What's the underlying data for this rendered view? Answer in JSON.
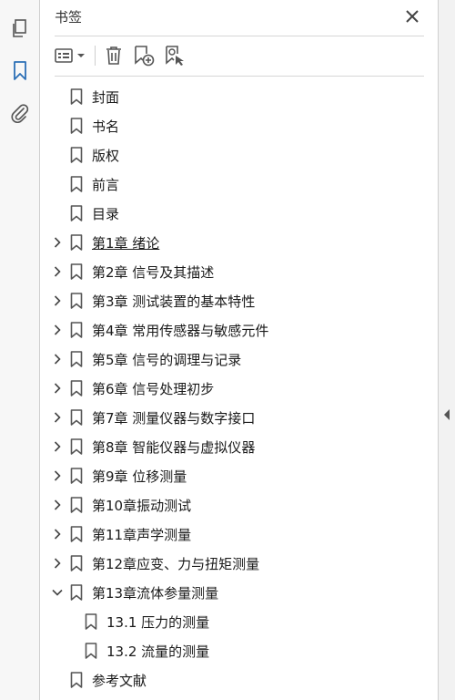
{
  "panel": {
    "title": "书签"
  },
  "left_rail": {
    "items": [
      {
        "name": "pages-icon",
        "active": false
      },
      {
        "name": "bookmark-icon",
        "active": true
      },
      {
        "name": "attachment-icon",
        "active": false
      }
    ]
  },
  "toolbar": {
    "options_icon": "list-options-icon",
    "delete_icon": "trash-icon",
    "new_bookmark_icon": "new-bookmark-icon",
    "bookmark_from_selection_icon": "bookmark-find-icon"
  },
  "bookmarks": [
    {
      "label": "封面",
      "level": 1,
      "expandable": false
    },
    {
      "label": "书名",
      "level": 1,
      "expandable": false
    },
    {
      "label": "版权",
      "level": 1,
      "expandable": false
    },
    {
      "label": "前言",
      "level": 1,
      "expandable": false
    },
    {
      "label": "目录",
      "level": 1,
      "expandable": false
    },
    {
      "label": "第1章 绪论",
      "level": 1,
      "expandable": true,
      "expanded": false,
      "hovered": true
    },
    {
      "label": "第2章 信号及其描述",
      "level": 1,
      "expandable": true,
      "expanded": false
    },
    {
      "label": "第3章 测试装置的基本特性",
      "level": 1,
      "expandable": true,
      "expanded": false
    },
    {
      "label": "第4章 常用传感器与敏感元件",
      "level": 1,
      "expandable": true,
      "expanded": false
    },
    {
      "label": "第5章 信号的调理与记录",
      "level": 1,
      "expandable": true,
      "expanded": false
    },
    {
      "label": "第6章 信号处理初步",
      "level": 1,
      "expandable": true,
      "expanded": false
    },
    {
      "label": "第7章 测量仪器与数字接口",
      "level": 1,
      "expandable": true,
      "expanded": false
    },
    {
      "label": "第8章 智能仪器与虚拟仪器",
      "level": 1,
      "expandable": true,
      "expanded": false
    },
    {
      "label": "第9章 位移测量",
      "level": 1,
      "expandable": true,
      "expanded": false
    },
    {
      "label": "第10章振动测试",
      "level": 1,
      "expandable": true,
      "expanded": false
    },
    {
      "label": "第11章声学测量",
      "level": 1,
      "expandable": true,
      "expanded": false
    },
    {
      "label": "第12章应变、力与扭矩测量",
      "level": 1,
      "expandable": true,
      "expanded": false
    },
    {
      "label": "第13章流体参量测量",
      "level": 1,
      "expandable": true,
      "expanded": true
    },
    {
      "label": "13.1 压力的测量",
      "level": 2,
      "expandable": false
    },
    {
      "label": "13.2 流量的测量",
      "level": 2,
      "expandable": false
    },
    {
      "label": "参考文献",
      "level": 1,
      "expandable": false
    }
  ],
  "colors": {
    "accent": "#2b6fb6",
    "icon": "#555555",
    "divider": "#d6d6d6"
  }
}
